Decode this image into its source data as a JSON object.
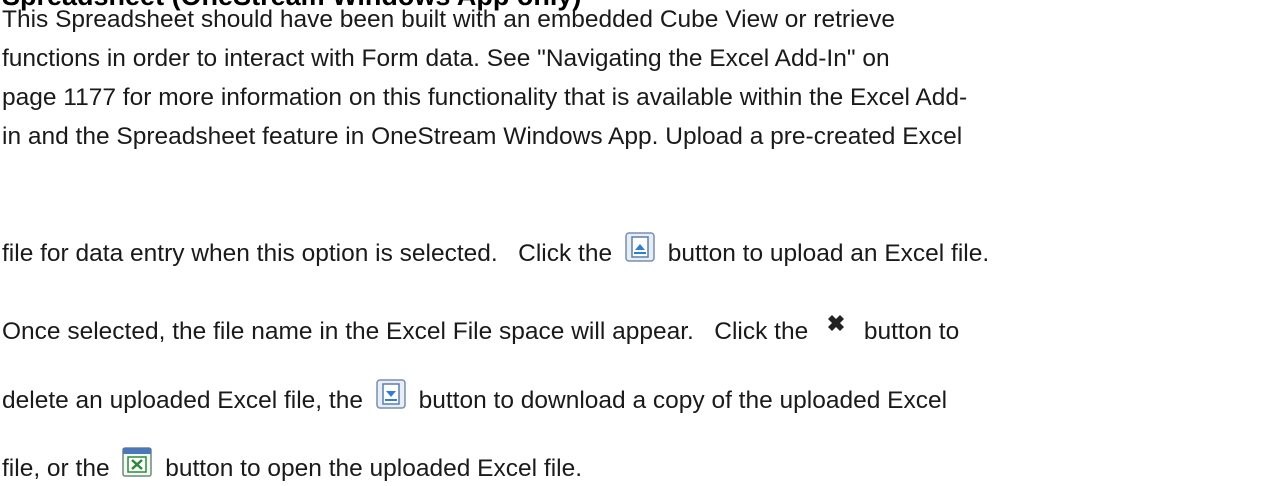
{
  "heading": "Spreadsheet (OneStream Windows App only)",
  "paragraph": {
    "line1": "This Spreadsheet should have been built with an embedded Cube View or retrieve",
    "line2": "functions in order to interact with Form data. See \"Navigating the Excel Add-In\" on",
    "line3": "page 1177 for more information on this functionality that is available within the Excel Add-",
    "line4": "in and the Spreadsheet feature in OneStream Windows App. Upload a pre-created Excel",
    "line5": "file for data entry when this option is selected.",
    "line6a": "Once selected, the file name in the Excel File space will appear.",
    "line6b": "button to",
    "line7a": "delete an uploaded Excel file, the",
    "line7b": "button to download a copy of the uploaded Excel",
    "line8a": "file, or the",
    "line8b": "button to open the uploaded Excel file.",
    "click_the": "Click the",
    "upload_tail": "button to upload an Excel file."
  },
  "icons": {
    "upload": "upload-icon",
    "delete": "delete-x-icon",
    "download": "download-icon",
    "open_excel": "excel-open-icon"
  },
  "colors": {
    "text": "#1a1a1a",
    "icon_blue": "#2f7fd1",
    "icon_green": "#2a8a3a"
  }
}
